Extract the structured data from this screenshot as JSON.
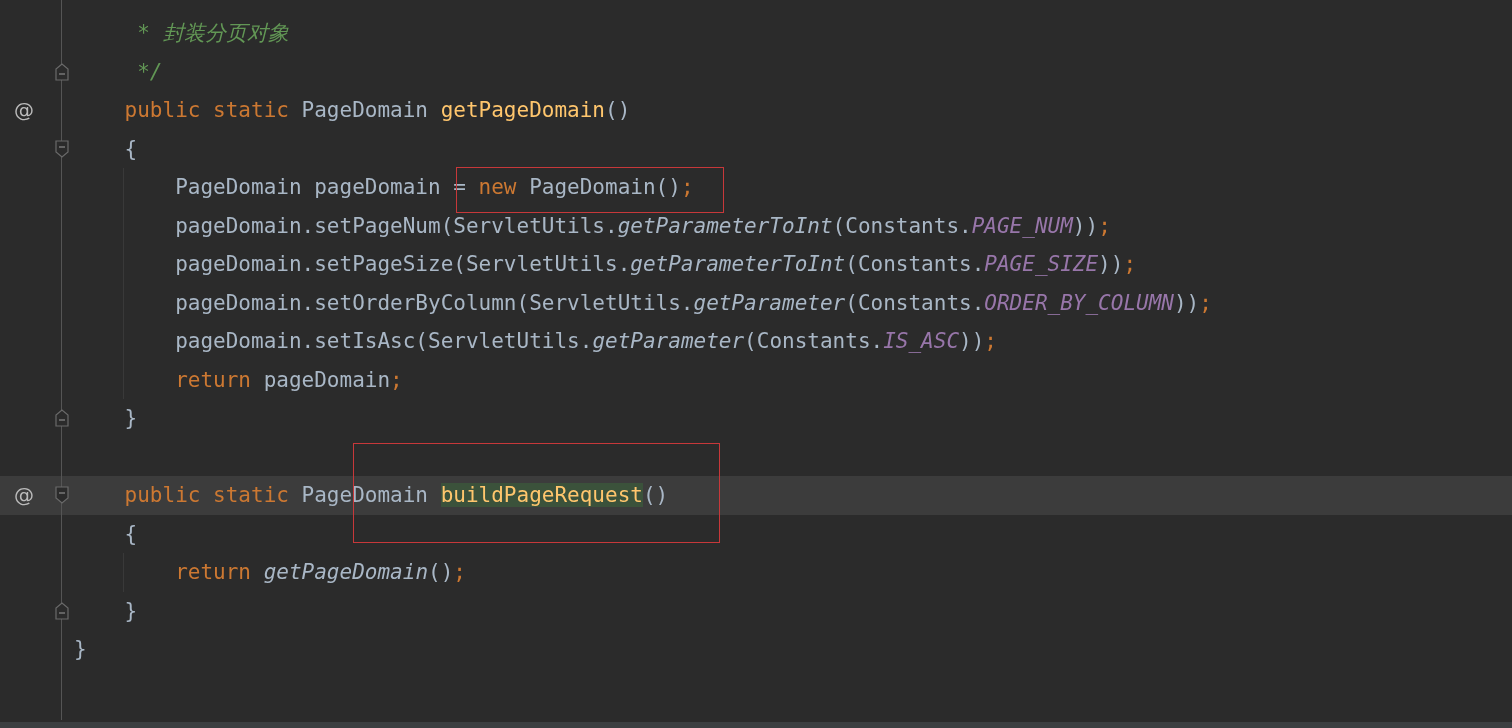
{
  "editor": {
    "lines": [
      {
        "current": false,
        "guide": false,
        "kind": "plain",
        "tokens": [
          {
            "kind": "comment",
            "text": "     * 封装分页对象"
          }
        ]
      },
      {
        "current": false,
        "guide": false,
        "kind": "fold-end",
        "tokens": [
          {
            "kind": "comment",
            "text": "     */"
          }
        ]
      },
      {
        "current": false,
        "guide": false,
        "kind": "plain",
        "gutter_mark": "@",
        "tokens": [
          {
            "kind": "kw",
            "text": "    public static "
          },
          {
            "kind": "text",
            "text": "PageDomain "
          },
          {
            "kind": "decl",
            "text": "getPageDomain",
            "highlighted": false
          },
          {
            "kind": "text",
            "text": "()"
          }
        ]
      },
      {
        "current": false,
        "guide": false,
        "kind": "fold-start",
        "tokens": [
          {
            "kind": "text",
            "text": "    {"
          }
        ]
      },
      {
        "current": false,
        "guide": true,
        "kind": "plain",
        "tokens": [
          {
            "kind": "text",
            "text": "        PageDomain pageDomain = "
          },
          {
            "kind": "kw",
            "text": "new"
          },
          {
            "kind": "text",
            "text": " PageDomain()"
          },
          {
            "kind": "semi",
            "text": ";"
          }
        ]
      },
      {
        "current": false,
        "guide": true,
        "kind": "plain",
        "tokens": [
          {
            "kind": "text",
            "text": "        pageDomain.setPageNum(ServletUtils."
          },
          {
            "kind": "call",
            "text": "getParameterToInt"
          },
          {
            "kind": "text",
            "text": "(Constants."
          },
          {
            "kind": "const",
            "text": "PAGE_NUM"
          },
          {
            "kind": "text",
            "text": "))"
          },
          {
            "kind": "semi",
            "text": ";"
          }
        ]
      },
      {
        "current": false,
        "guide": true,
        "kind": "plain",
        "tokens": [
          {
            "kind": "text",
            "text": "        pageDomain.setPageSize(ServletUtils."
          },
          {
            "kind": "call",
            "text": "getParameterToInt"
          },
          {
            "kind": "text",
            "text": "(Constants."
          },
          {
            "kind": "const",
            "text": "PAGE_SIZE"
          },
          {
            "kind": "text",
            "text": "))"
          },
          {
            "kind": "semi",
            "text": ";"
          }
        ]
      },
      {
        "current": false,
        "guide": true,
        "kind": "plain",
        "tokens": [
          {
            "kind": "text",
            "text": "        pageDomain.setOrderByColumn(ServletUtils."
          },
          {
            "kind": "call",
            "text": "getParameter"
          },
          {
            "kind": "text",
            "text": "(Constants."
          },
          {
            "kind": "const",
            "text": "ORDER_BY_COLUMN"
          },
          {
            "kind": "text",
            "text": "))"
          },
          {
            "kind": "semi",
            "text": ";"
          }
        ]
      },
      {
        "current": false,
        "guide": true,
        "kind": "plain",
        "tokens": [
          {
            "kind": "text",
            "text": "        pageDomain.setIsAsc(ServletUtils."
          },
          {
            "kind": "call",
            "text": "getParameter"
          },
          {
            "kind": "text",
            "text": "(Constants."
          },
          {
            "kind": "const",
            "text": "IS_ASC"
          },
          {
            "kind": "text",
            "text": "))"
          },
          {
            "kind": "semi",
            "text": ";"
          }
        ]
      },
      {
        "current": false,
        "guide": true,
        "kind": "plain",
        "tokens": [
          {
            "kind": "kw",
            "text": "        return"
          },
          {
            "kind": "text",
            "text": " pageDomain"
          },
          {
            "kind": "semi",
            "text": ";"
          }
        ]
      },
      {
        "current": false,
        "guide": false,
        "kind": "fold-end",
        "tokens": [
          {
            "kind": "text",
            "text": "    }"
          }
        ]
      },
      {
        "current": false,
        "guide": false,
        "kind": "plain"
      },
      {
        "current": true,
        "guide": false,
        "kind": "fold-start",
        "gutter_mark": "@",
        "tokens": [
          {
            "kind": "kw",
            "text": "    public static "
          },
          {
            "kind": "text",
            "text": "PageDomain "
          },
          {
            "kind": "decl",
            "text": "buildPageRequest",
            "highlighted": true
          },
          {
            "kind": "text",
            "text": "()"
          }
        ]
      },
      {
        "current": false,
        "guide": false,
        "kind": "plain",
        "tokens": [
          {
            "kind": "text",
            "text": "    {"
          }
        ]
      },
      {
        "current": false,
        "guide": true,
        "kind": "plain",
        "tokens": [
          {
            "kind": "kw",
            "text": "        return"
          },
          {
            "kind": "call",
            "text": " getPageDomain"
          },
          {
            "kind": "text",
            "text": "()"
          },
          {
            "kind": "semi",
            "text": ";"
          }
        ]
      },
      {
        "current": false,
        "guide": false,
        "kind": "fold-end",
        "tokens": [
          {
            "kind": "text",
            "text": "    }"
          }
        ]
      },
      {
        "current": false,
        "guide": false,
        "kind": "plain",
        "tokens": [
          {
            "kind": "text",
            "text": "}"
          }
        ]
      }
    ]
  }
}
